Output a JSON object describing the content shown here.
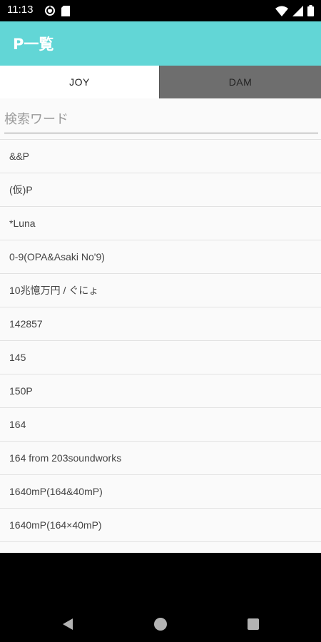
{
  "status_bar": {
    "time": "11:13",
    "icons": [
      "sync-icon",
      "sd-card-icon",
      "wifi-icon",
      "signal-icon",
      "battery-icon"
    ]
  },
  "app_bar": {
    "title": "P一覧",
    "color": "#62d6d6"
  },
  "tabs": [
    {
      "label": "JOY",
      "selected": true
    },
    {
      "label": "DAM",
      "selected": false
    }
  ],
  "search": {
    "placeholder": "検索ワード",
    "value": ""
  },
  "list": {
    "items": [
      "&&P",
      "(仮)P",
      "*Luna",
      "0-9(OPA&Asaki No'9)",
      "10兆憶万円 / ぐにょ",
      "142857",
      "145",
      "150P",
      "164",
      "164 from 203soundworks",
      "1640mP(164&40mP)",
      "1640mP(164×40mP)",
      ""
    ]
  },
  "nav_bar": {
    "icons": [
      "back-icon",
      "home-icon",
      "recents-icon"
    ]
  }
}
